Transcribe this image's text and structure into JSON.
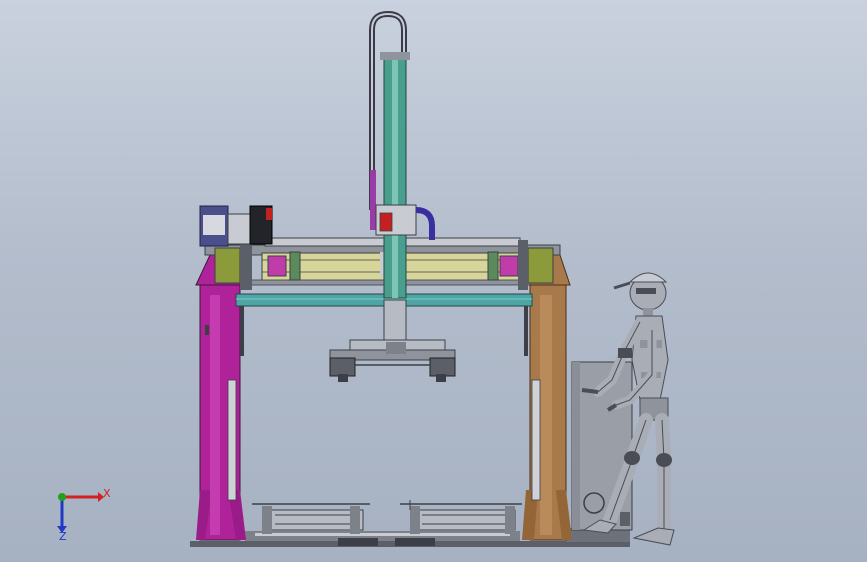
{
  "view": {
    "background_top": "#c9d1de",
    "background_bottom": "#a6b1c2"
  },
  "axes": {
    "x_label": "X",
    "z_label": "Z",
    "x_color": "#d42020",
    "y_color": "#1fa01f",
    "z_color": "#2038c8"
  },
  "colors": {
    "left_column": "#b0229a",
    "right_column": "#a8794a",
    "crossbeam": "#4fa4a4",
    "vertical_mast": "#4a9e8e",
    "rail": "#d7d59a",
    "cable_chain": "#3a3a4a",
    "hose": "#3b2e9e",
    "bearing_pink": "#c03ca8",
    "frame_dark": "#3c3f47",
    "light_metal": "#c8ccd2",
    "cabinet": "#9a9ea6",
    "mannequin": "#a9adb5",
    "mannequin_dark": "#4a4d55"
  },
  "icons": {
    "triad": "coordinate-triad-icon"
  }
}
